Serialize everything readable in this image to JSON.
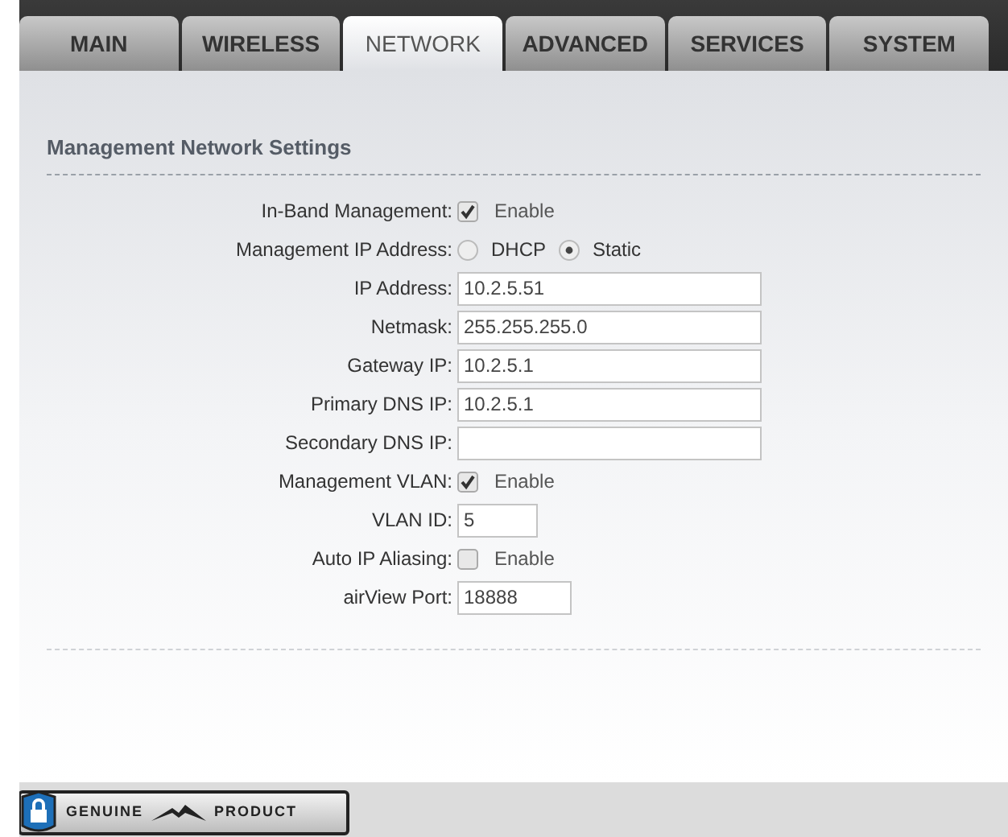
{
  "tabs": [
    {
      "label": "MAIN",
      "selected": false
    },
    {
      "label": "WIRELESS",
      "selected": false
    },
    {
      "label": "NETWORK",
      "selected": true
    },
    {
      "label": "ADVANCED",
      "selected": false
    },
    {
      "label": "SERVICES",
      "selected": false
    },
    {
      "label": "SYSTEM",
      "selected": false
    }
  ],
  "section_title": "Management Network Settings",
  "rows": [
    {
      "kind": "checkbox",
      "label": "In-Band Management:",
      "option": "Enable",
      "checked": true
    },
    {
      "kind": "radio",
      "label": "Management IP Address:",
      "options": [
        {
          "label": "DHCP",
          "selected": false
        },
        {
          "label": "Static",
          "selected": true
        }
      ]
    },
    {
      "kind": "field",
      "label": "IP Address:",
      "value": "10.2.5.51"
    },
    {
      "kind": "field",
      "label": "Netmask:",
      "value": "255.255.255.0"
    },
    {
      "kind": "field",
      "label": "Gateway IP:",
      "value": "10.2.5.1"
    },
    {
      "kind": "field",
      "label": "Primary DNS IP:",
      "value": "10.2.5.1"
    },
    {
      "kind": "field",
      "label": "Secondary DNS IP:"
    },
    {
      "kind": "checkbox",
      "label": "Management VLAN:",
      "option": "Enable",
      "checked": true
    },
    {
      "kind": "short_field",
      "label": "VLAN ID:",
      "value": "5"
    },
    {
      "kind": "checkbox",
      "label": "Auto IP Aliasing:",
      "option": "Enable",
      "checked": false
    },
    {
      "kind": "port_field",
      "label": "airView Port:",
      "value": "18888"
    }
  ],
  "badge": {
    "left": "GENUINE",
    "right": "PRODUCT"
  }
}
